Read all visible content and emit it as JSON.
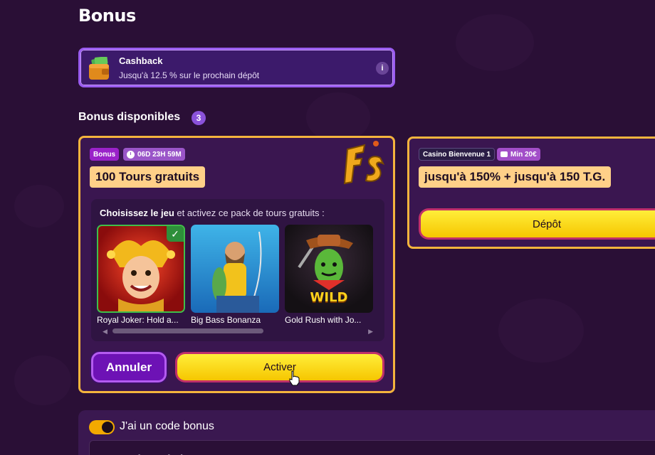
{
  "page": {
    "title": "Bonus"
  },
  "cashback": {
    "title": "Cashback",
    "subtitle": "Jusqu'à 12.5 % sur le prochain dépôt",
    "info_icon": "info-icon",
    "info_label": "i"
  },
  "available": {
    "title": "Bonus disponibles",
    "count": "3"
  },
  "bonus_card": {
    "tag": "Bonus",
    "timer": "06D 23H 59M",
    "offer": "100 Tours gratuits",
    "choose_bold": "Choisissez le jeu",
    "choose_rest": " et activez ce pack de tours gratuits :",
    "games": [
      {
        "name": "Royal Joker: Hold a...",
        "selected": true
      },
      {
        "name": "Big Bass Bonanza",
        "selected": false
      },
      {
        "name": "Gold Rush with Jo...",
        "selected": false
      }
    ],
    "wild_label": "WILD",
    "check_mark": "✓",
    "cancel_label": "Annuler",
    "activate_label": "Activer"
  },
  "card2": {
    "tag": "Casino Bienvenue 1",
    "min": "Min 20€",
    "offer": "jusqu'à 150% + jusqu'à 150 T.G.",
    "deposit_label": "Dépôt"
  },
  "code": {
    "toggle_on": true,
    "label": "J'ai un code bonus",
    "placeholder": "Entrez le code bonus"
  },
  "colors": {
    "background": "#2a0f36",
    "accent_gold": "#f4b43d",
    "accent_purple": "#9a5cf0",
    "button_yellow": "#ffe21a",
    "toggle": "#f2a900"
  }
}
